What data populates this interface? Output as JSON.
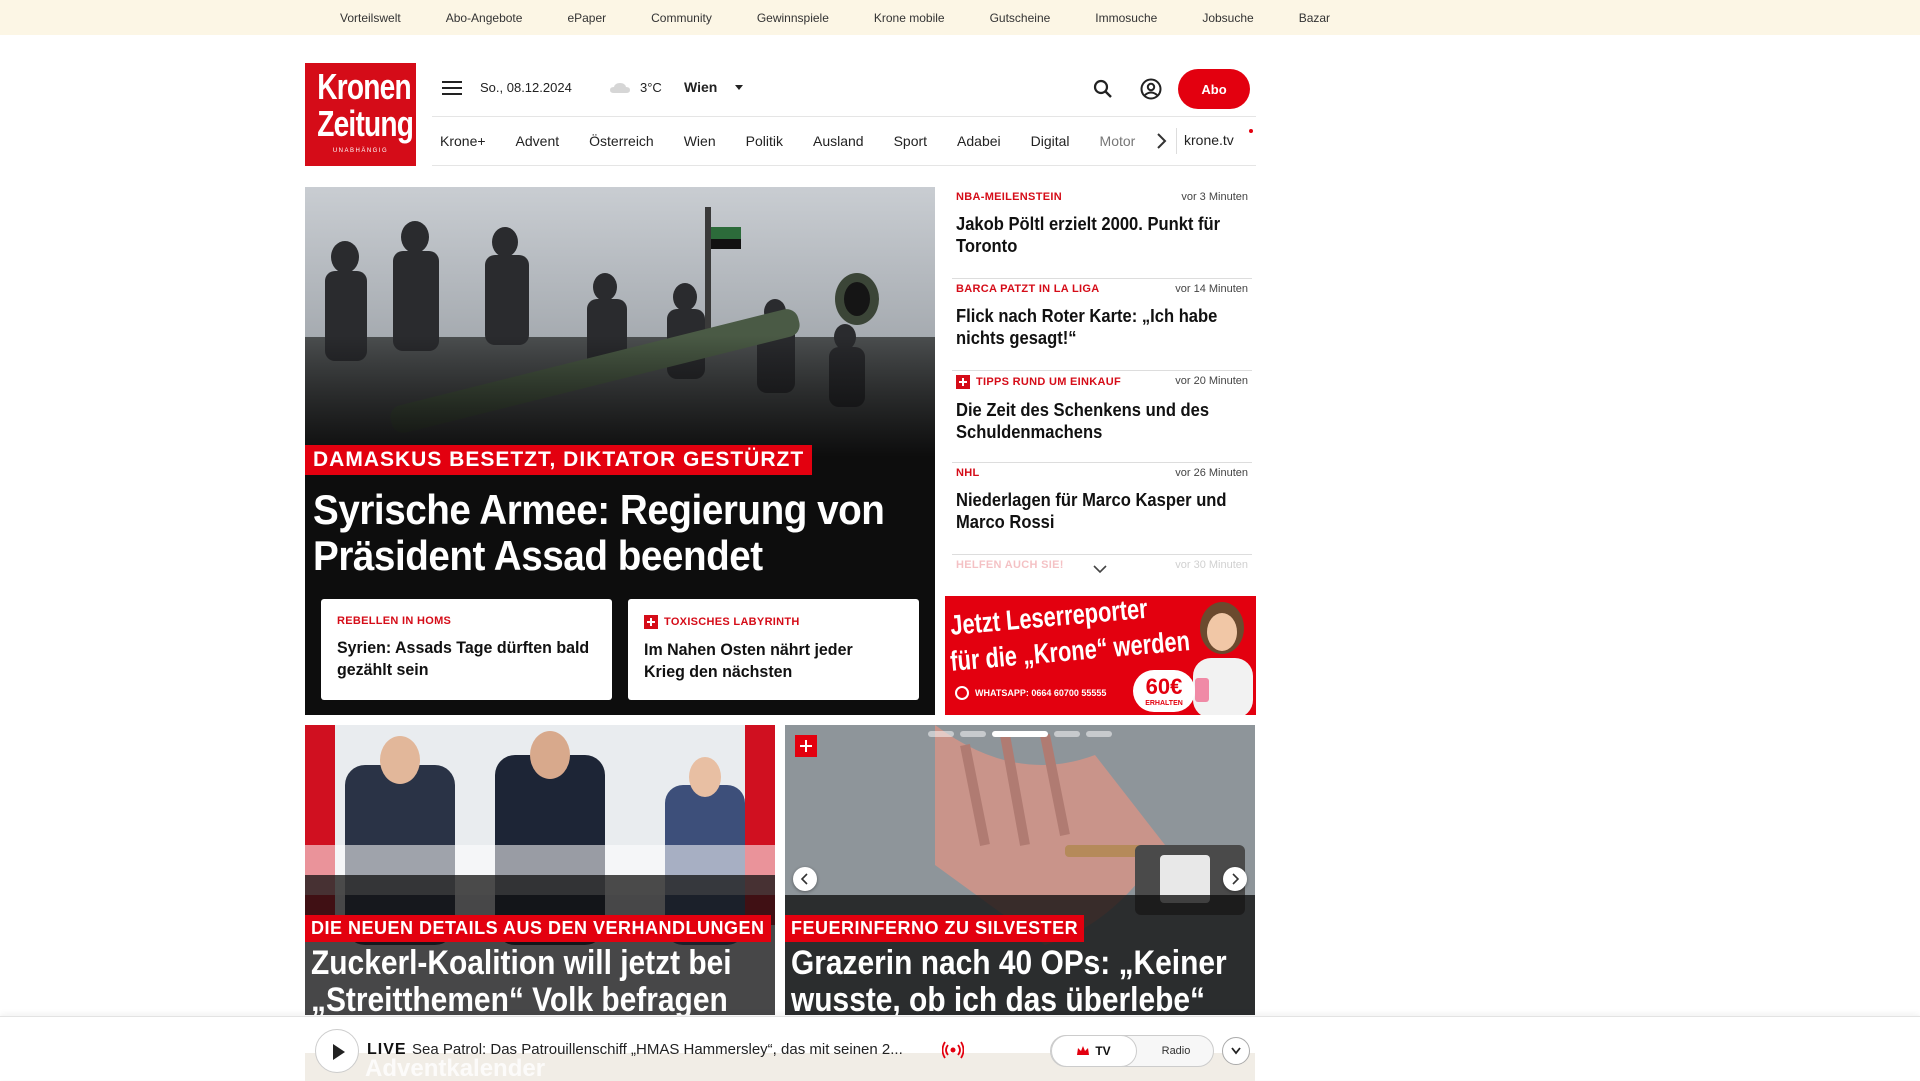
{
  "topbar": {
    "links": [
      "Vorteilswelt",
      "Abo-Angebote",
      "ePaper",
      "Community",
      "Gewinnspiele",
      "Krone mobile",
      "Gutscheine",
      "Immosuche",
      "Jobsuche",
      "Bazar"
    ]
  },
  "logo": {
    "line1": "Kronen",
    "line2": "Zeitung",
    "line3": "UNABHÄNGIG"
  },
  "header": {
    "date": "So., 08.12.2024",
    "weather_icon": "cloud-icon",
    "temperature": "3°C",
    "city": "Wien",
    "subscribe_label": "Abo"
  },
  "nav": {
    "items": [
      "Krone+",
      "Advent",
      "Österreich",
      "Wien",
      "Politik",
      "Ausland",
      "Sport",
      "Adabei",
      "Digital",
      "Motor"
    ],
    "tv_link": "krone.tv"
  },
  "hero": {
    "kicker": "DAMASKUS BESETZT, DIKTATOR GESTÜRZT",
    "headline": "Syrische Armee: Regierung von Präsident Assad beendet",
    "subcards": [
      {
        "kicker": "REBELLEN IN HOMS",
        "title": "Syrien: Assads Tage dürften bald gezählt sein",
        "plus": false
      },
      {
        "kicker": "TOXISCHES LABYRINTH",
        "title": "Im Nahen Osten nährt jeder Krieg den nächsten",
        "plus": true
      }
    ]
  },
  "news": [
    {
      "kicker": "NBA-MEILENSTEIN",
      "time": "vor 3 Minuten",
      "title": "Jakob Pöltl erzielt 2000. Punkt für Toronto",
      "plus": false
    },
    {
      "kicker": "BARCA PATZT IN LA LIGA",
      "time": "vor 14 Minuten",
      "title": "Flick nach Roter Karte: „Ich habe nichts gesagt!“",
      "plus": false
    },
    {
      "kicker": "TIPPS RUND UM EINKAUF",
      "time": "vor 20 Minuten",
      "title": "Die Zeit des Schenkens und des Schuldenmachens",
      "plus": true
    },
    {
      "kicker": "NHL",
      "time": "vor 26 Minuten",
      "title": "Niederlagen für Marco Kasper und Marco Rossi",
      "plus": false
    },
    {
      "kicker": "HELFEN AUCH SIE!",
      "time": "vor 30 Minuten",
      "title": "",
      "plus": false
    }
  ],
  "ad": {
    "line1": "Jetzt Leserreporter",
    "line2": "für die „Krone“ werden",
    "whatsapp": "WHATSAPP: 0664 60700 55555",
    "amount": "60€",
    "amount_label": "ERHALTEN"
  },
  "teasers": [
    {
      "kicker": "DIE NEUEN DETAILS AUS DEN VERHANDLUNGEN",
      "headline": "Zuckerl-Koalition will jetzt bei „Streitthemen“ Volk befragen"
    },
    {
      "kicker": "FEUERINFERNO ZU SILVESTER",
      "headline": "Grazerin nach 40 OPs: „Keiner wusste, ob ich das überlebe“",
      "slide_active": 3,
      "slide_count": 6
    }
  ],
  "livebar": {
    "live_label": "LIVE",
    "now_playing": "Sea Patrol: Das Patrouillenschiff „HMAS Hammersley“, das mit seinen 2...",
    "tv_label": "TV",
    "radio_label": "Radio",
    "background_text": "Adventkalender"
  },
  "colors": {
    "brand_red": "#e3000f",
    "topbar_bg": "#fcf6e5"
  }
}
